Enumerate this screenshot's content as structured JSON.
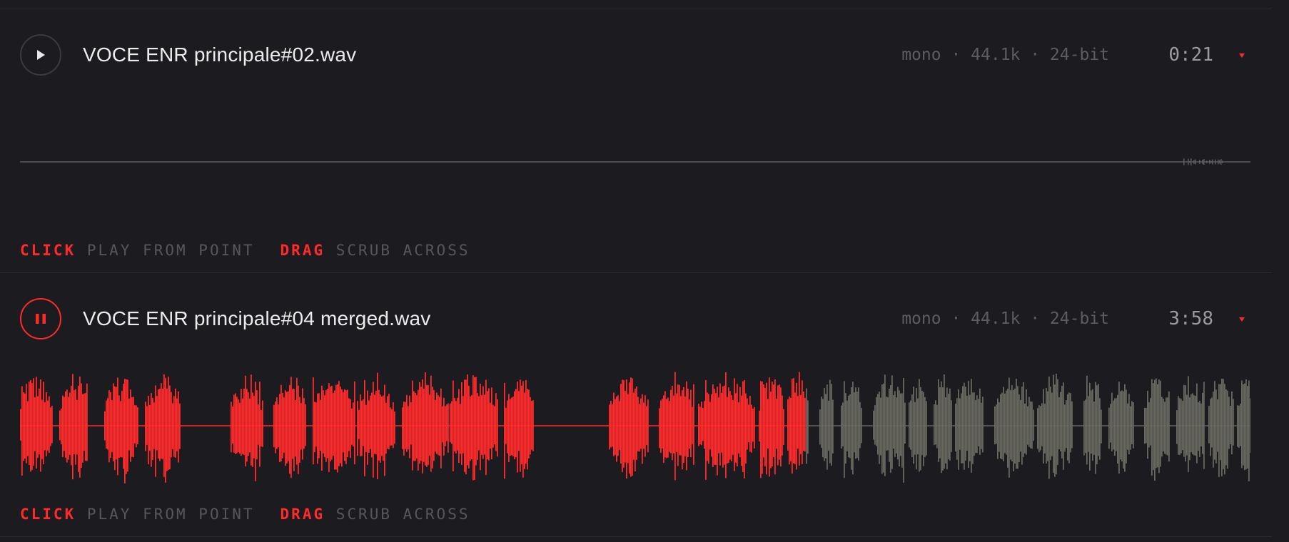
{
  "colors": {
    "background": "#1c1c20",
    "accent": "#ff2a2a",
    "waveform_unplayed": "#67675f",
    "waveform_idle": "#5a5a5e"
  },
  "tracks": [
    {
      "title": "VOCE ENR principale#02.wav",
      "meta": "mono · 44.1k · 24-bit",
      "duration": "0:21",
      "state": "paused",
      "button_icon": "play-icon",
      "progress": 0,
      "hint": {
        "click_key": "CLICK",
        "click_desc": "PLAY FROM POINT",
        "drag_key": "DRAG",
        "drag_desc": "SCRUB ACROSS"
      }
    },
    {
      "title": "VOCE ENR principale#04 merged.wav",
      "meta": "mono · 44.1k · 24-bit",
      "duration": "3:58",
      "state": "playing",
      "button_icon": "pause-icon",
      "progress": 0.64,
      "hint": {
        "click_key": "CLICK",
        "click_desc": "PLAY FROM POINT",
        "drag_key": "DRAG",
        "drag_desc": "SCRUB ACROSS"
      }
    }
  ]
}
